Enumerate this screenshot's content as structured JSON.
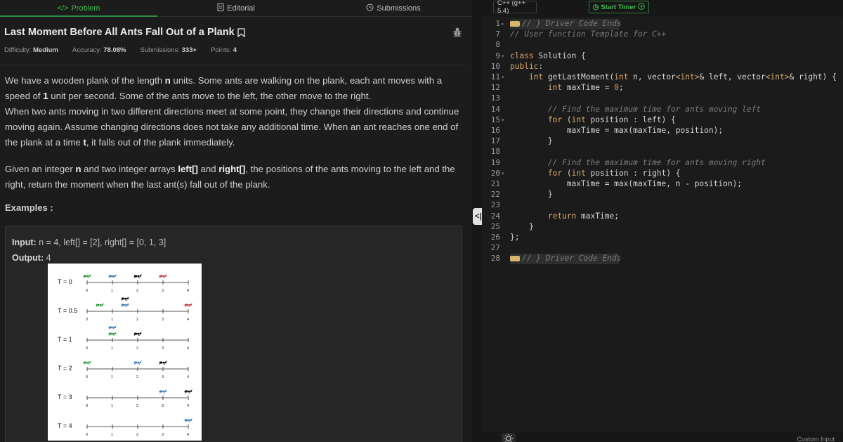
{
  "tabs": [
    {
      "label": "Problem",
      "icon": "code-icon",
      "active": true
    },
    {
      "label": "Editorial",
      "icon": "document-icon",
      "active": false
    },
    {
      "label": "Submissions",
      "icon": "clock-icon",
      "active": false
    }
  ],
  "problem": {
    "title": "Last Moment Before All Ants Fall Out of a Plank",
    "meta": {
      "difficulty_label": "Difficulty:",
      "difficulty": "Medium",
      "accuracy_label": "Accuracy:",
      "accuracy": "78.08%",
      "submissions_label": "Submissions:",
      "submissions": "333+",
      "points_label": "Points:",
      "points": "4"
    },
    "p1_a": "We have a wooden plank of the length ",
    "p1_n": "n",
    "p1_b": " units. Some ants are walking on the plank, each ant moves with a speed of ",
    "p1_one": "1",
    "p1_c": " unit per second. Some of the ants move to the left, the other move to the right.",
    "p1_d": "When two ants moving in two different directions meet at some point, they change their directions and continue moving again. Assume changing directions does not take any additional time. When an ant reaches one end of the plank at a time ",
    "p1_t": "t",
    "p1_e": ", it falls out of the plank immediately.",
    "p2_a": "Given an integer ",
    "p2_n": "n",
    "p2_b": " and two integer arrays ",
    "p2_left": "left[]",
    "p2_c": " and ",
    "p2_right": "right[]",
    "p2_d": ", the positions of the ants moving to the left and the right, return the moment when the last ant(s) fall out of the plank.",
    "examples_label": "Examples :",
    "input_label": "Input:",
    "input_value": "n = 4, left[] = [2], right[] = [0, 1, 3]",
    "output_label": "Output:",
    "output_value": "4",
    "figure": {
      "rows": [
        "T = 0",
        "T = 0.5",
        "T = 1",
        "T = 2",
        "T = 3",
        "T = 4"
      ],
      "ticks": [
        "0",
        "1",
        "2",
        "3",
        "4"
      ]
    }
  },
  "editor": {
    "language": "C++ (g++ 5.4)",
    "timer_label": "Start Timer",
    "lines": [
      {
        "n": "1",
        "fold": "▸",
        "html": "<span class='foldmark'></span><span class='cm'>// } Driver Code Ends</span>",
        "hl": true
      },
      {
        "n": "7",
        "fold": "",
        "html": "<span class='cm'>// User function Template for C++</span>"
      },
      {
        "n": "8",
        "fold": "",
        "html": ""
      },
      {
        "n": "9",
        "fold": "▾",
        "html": "<span class='kw'>class</span> Solution {"
      },
      {
        "n": "10",
        "fold": "",
        "html": "<span class='kw'>public</span>:"
      },
      {
        "n": "11",
        "fold": "▾",
        "html": "    <span class='ty'>int</span> getLastMoment(<span class='ty'>int</span> n, vector<span class='ty'>&lt;int&gt;</span>&amp; left, vector<span class='ty'>&lt;int&gt;</span>&amp; right) {"
      },
      {
        "n": "12",
        "fold": "",
        "html": "        <span class='ty'>int</span> maxTime = <span class='num'>0</span>;"
      },
      {
        "n": "13",
        "fold": "",
        "html": ""
      },
      {
        "n": "14",
        "fold": "",
        "html": "        <span class='cm'>// Find the maximum time for ants moving left</span>"
      },
      {
        "n": "15",
        "fold": "▾",
        "html": "        <span class='kw'>for</span> (<span class='ty'>int</span> position : left) {"
      },
      {
        "n": "16",
        "fold": "",
        "html": "            maxTime = max(maxTime, position);"
      },
      {
        "n": "17",
        "fold": "",
        "html": "        }"
      },
      {
        "n": "18",
        "fold": "",
        "html": ""
      },
      {
        "n": "19",
        "fold": "",
        "html": "        <span class='cm'>// Find the maximum time for ants moving right</span>"
      },
      {
        "n": "20",
        "fold": "▾",
        "html": "        <span class='kw'>for</span> (<span class='ty'>int</span> position : right) {"
      },
      {
        "n": "21",
        "fold": "",
        "html": "            maxTime = max(maxTime, n - position);"
      },
      {
        "n": "22",
        "fold": "",
        "html": "        }"
      },
      {
        "n": "23",
        "fold": "",
        "html": ""
      },
      {
        "n": "24",
        "fold": "",
        "html": "        <span class='kw'>return</span> maxTime;"
      },
      {
        "n": "25",
        "fold": "",
        "html": "    }"
      },
      {
        "n": "26",
        "fold": "",
        "html": "};"
      },
      {
        "n": "27",
        "fold": "",
        "html": ""
      },
      {
        "n": "28",
        "fold": "",
        "html": "<span class='foldmark'></span><span class='cm'>// } Driver Code Ends</span>",
        "hl": true
      }
    ]
  },
  "bottom": {
    "custom_input": "Custom Input"
  },
  "colors": {
    "accent": "#3fb950",
    "bg": "#1c1c1c"
  }
}
